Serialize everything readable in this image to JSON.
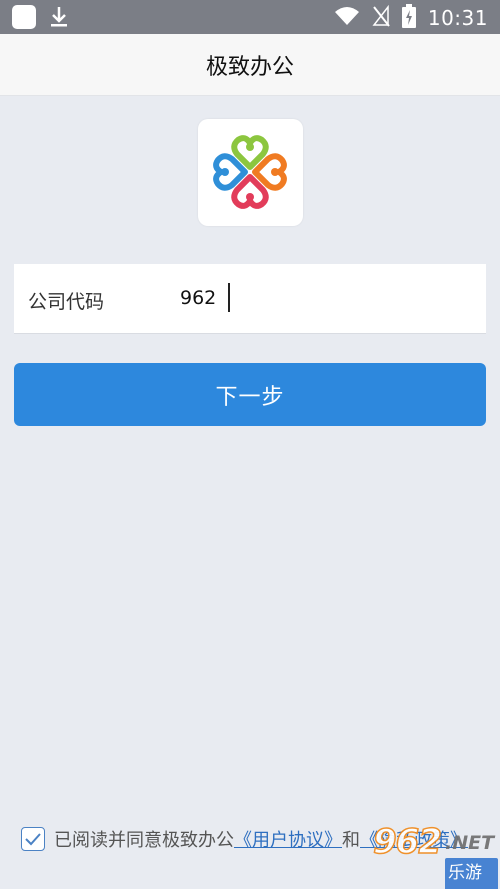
{
  "status_bar": {
    "time": "10:31",
    "icons": [
      "notification-square-icon",
      "download-icon",
      "wifi-icon",
      "no-signal-icon",
      "battery-charging-icon"
    ]
  },
  "header": {
    "title": "极致办公"
  },
  "logo": {
    "icon": "app-logo-icon",
    "colors": [
      "#8cc63f",
      "#f07b22",
      "#e23c5a",
      "#2f8fd8"
    ]
  },
  "form": {
    "company_code_label": "公司代码",
    "company_code_value": "962"
  },
  "next_button": {
    "label": "下一步",
    "color": "#2d88dd"
  },
  "agreement": {
    "checked": true,
    "prefix": "已阅读并同意极致办公",
    "user_agreement": "《用户协议》",
    "conjunction": "和",
    "privacy_policy": "《隐私政策》"
  },
  "watermark": {
    "brand": "962",
    "suffix": ".NET",
    "sub": "乐游网"
  }
}
